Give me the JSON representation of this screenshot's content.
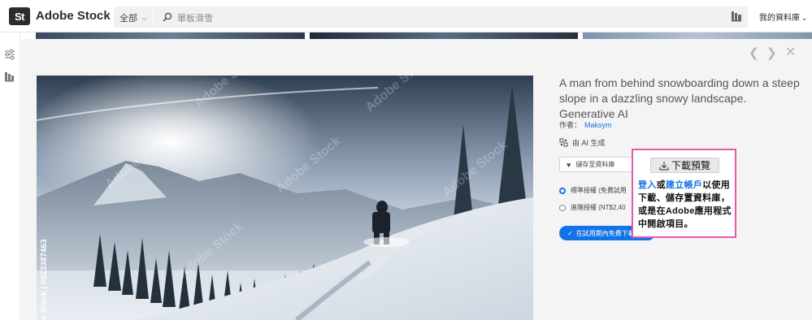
{
  "app": {
    "logo_letters": "St",
    "brand": "Adobe Stock"
  },
  "search": {
    "scope_label": "全部",
    "placeholder": "單板滑雪"
  },
  "header": {
    "my_library": "我的資料庫"
  },
  "asset": {
    "title": "A man from behind snowboarding down a steep slope in a dazzling snowy landscape. Generative AI",
    "author_prefix": "作者：",
    "author_name": "Maksym",
    "ai_label": "由 AI 生成",
    "save_label": "儲存至資料庫",
    "license_standard": "標準授權 (免費試用",
    "license_extended": "進階授權 (NT$2,40",
    "trial_button": "在試用期內免費下載",
    "watermark_id": "e Stock | #623387463",
    "watermark_text": "Adobe Stock"
  },
  "popup": {
    "download_label": "下載預覽",
    "link_login": "登入",
    "text_or": "或",
    "link_signup": "建立帳戶",
    "text_rest": "以使用下載、儲存置資料庫，或是在Adobe應用程式中開啟項目。"
  },
  "colors": {
    "accent": "#1473e6",
    "popup_border": "#e35ba8"
  }
}
